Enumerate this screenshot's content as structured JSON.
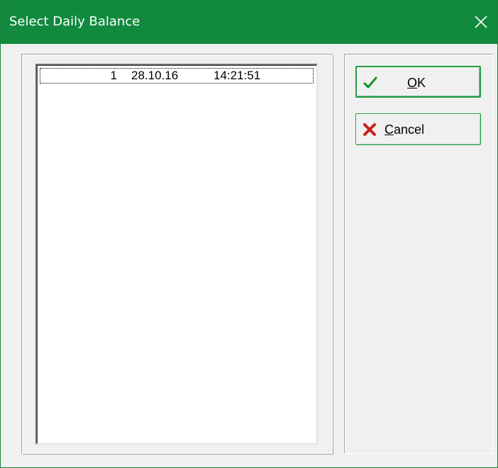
{
  "window": {
    "title": "Select Daily Balance",
    "colors": {
      "titlebar": "#118a3e",
      "button_border": "#1f9b45",
      "ok_check": "#1aa33a",
      "cancel_x": "#d6221c"
    }
  },
  "list": {
    "rows": [
      {
        "number": "1",
        "date": "28.10.16",
        "time": "14:21:51"
      }
    ]
  },
  "buttons": {
    "ok": {
      "mnemonic": "O",
      "rest": "K",
      "icon": "checkmark-icon"
    },
    "cancel": {
      "mnemonic": "C",
      "rest": "ancel",
      "icon": "red-x-icon"
    }
  }
}
